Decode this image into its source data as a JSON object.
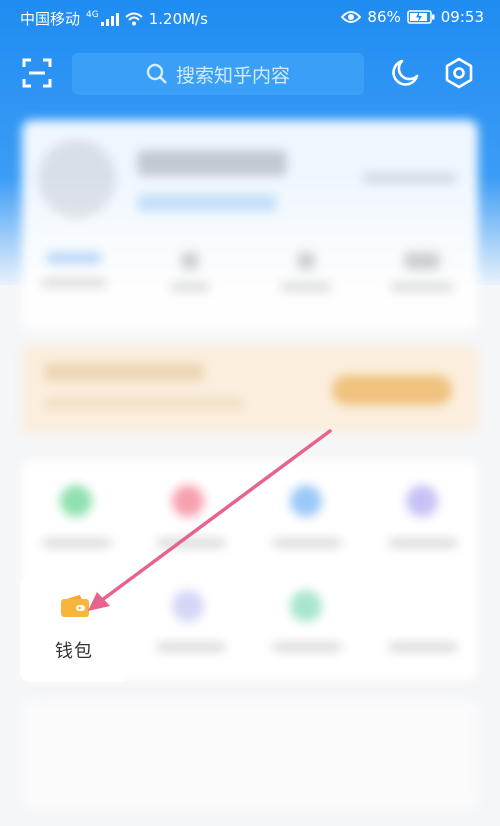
{
  "status_bar": {
    "carrier": "中国移动",
    "network": "4G",
    "speed": "1.20M/s",
    "battery": "86%",
    "time": "09:53"
  },
  "top_bar": {
    "search_placeholder": "搜索知乎内容",
    "icons": [
      "scan-icon",
      "search-icon",
      "moon-icon",
      "settings-icon"
    ]
  },
  "tools": {
    "wallet_label": "钱包"
  },
  "colors": {
    "header": "#1f8cf2",
    "annotation_arrow": "#e8628e",
    "wallet_icon": "#f6b63b"
  }
}
